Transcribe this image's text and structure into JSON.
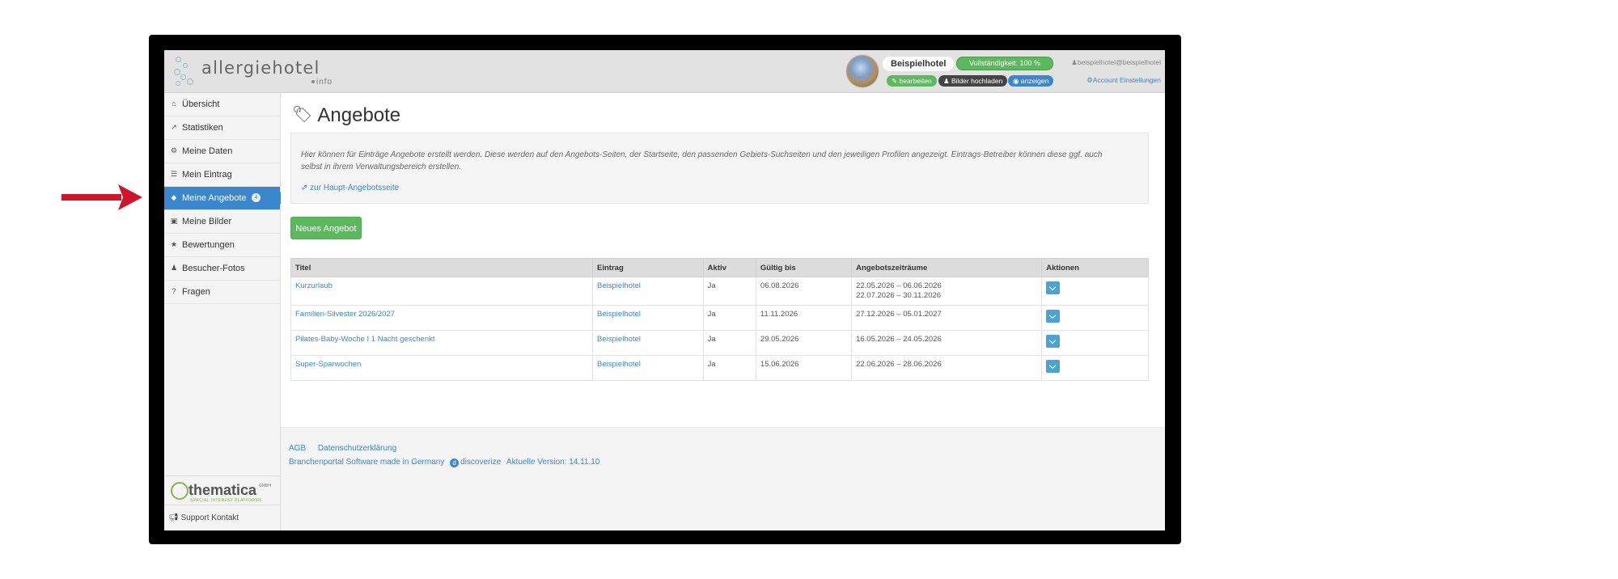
{
  "header": {
    "logo_main": "allergiehotel",
    "logo_sub": "info",
    "hotel_name": "Beispielhotel",
    "completeness": "Vollständigkeit: 100 %",
    "btn_edit": "bearbeiten",
    "btn_upload": "Bilder hochladen",
    "btn_view": "anzeigen",
    "user_email": "beispielhotel@beispielhotel",
    "account_settings": "Account Einstellungen"
  },
  "sidebar": {
    "items": [
      {
        "label": "Übersicht",
        "icon": "home-icon"
      },
      {
        "label": "Statistiken",
        "icon": "chart-icon"
      },
      {
        "label": "Meine Daten",
        "icon": "gear-icon"
      },
      {
        "label": "Mein Eintrag",
        "icon": "list-icon"
      },
      {
        "label": "Meine Angebote",
        "icon": "tag-icon",
        "badge": "4"
      },
      {
        "label": "Meine Bilder",
        "icon": "camera-icon"
      },
      {
        "label": "Bewertungen",
        "icon": "star-icon"
      },
      {
        "label": "Besucher-Fotos",
        "icon": "user-icon"
      },
      {
        "label": "Fragen",
        "icon": "question-icon"
      }
    ],
    "brand": "thematica",
    "brand_suffix": "GMBH",
    "brand_tagline": "SPECIAL INTEREST PLATFORMS",
    "support": "Support Kontakt"
  },
  "main": {
    "title": "Angebote",
    "info_text": "Hier können für Einträge Angebote erstellt werden. Diese werden auf den Angebots-Seiten, der Startseite, den passenden Gebiets-Suchseiten und den jeweiligen Profilen angezeigt. Eintrags-Betreiber können diese ggf. auch selbst in ihrem Verwaltungsbereich erstellen.",
    "info_link": "zur Haupt-Angebotsseite",
    "new_offer_button": "Neues Angebot",
    "table": {
      "headers": [
        "Titel",
        "Eintrag",
        "Aktiv",
        "Gültig bis",
        "Angebotszeiträume",
        "Aktionen"
      ],
      "rows": [
        {
          "title": "Kurzurlaub",
          "entry": "Beispielhotel",
          "active": "Ja",
          "valid_until": "06.08.2026",
          "period1": "22.05.2026 – 06.06.2026",
          "period2": "22.07.2026 – 30.11.2026"
        },
        {
          "title": "Familien-Silvester 2026/2027",
          "entry": "Beispielhotel",
          "active": "Ja",
          "valid_until": "11.11.2026",
          "period1": "27.12.2026 – 05.01.2027",
          "period2": ""
        },
        {
          "title": "Pilates-Baby-Woche I 1 Nacht geschenkt",
          "entry": "Beispielhotel",
          "active": "Ja",
          "valid_until": "29.05.2026",
          "period1": "16.05.2026 – 24.05.2026",
          "period2": ""
        },
        {
          "title": "Super-Sparwochen",
          "entry": "Beispielhotel",
          "active": "Ja",
          "valid_until": "15.06.2026",
          "period1": "22.06.2026 – 28.06.2026",
          "period2": ""
        }
      ]
    }
  },
  "footer": {
    "agb": "AGB",
    "privacy": "Datenschutzerklärung",
    "made_in": "Branchenportal Software made in Germany",
    "discoverize": "discoverize",
    "version": "Aktuelle Version: 14.11.10"
  },
  "colors": {
    "accent": "#3a87ce",
    "success": "#5cb85c",
    "arrow": "#d0142a",
    "brand_green": "#8ab54b"
  }
}
